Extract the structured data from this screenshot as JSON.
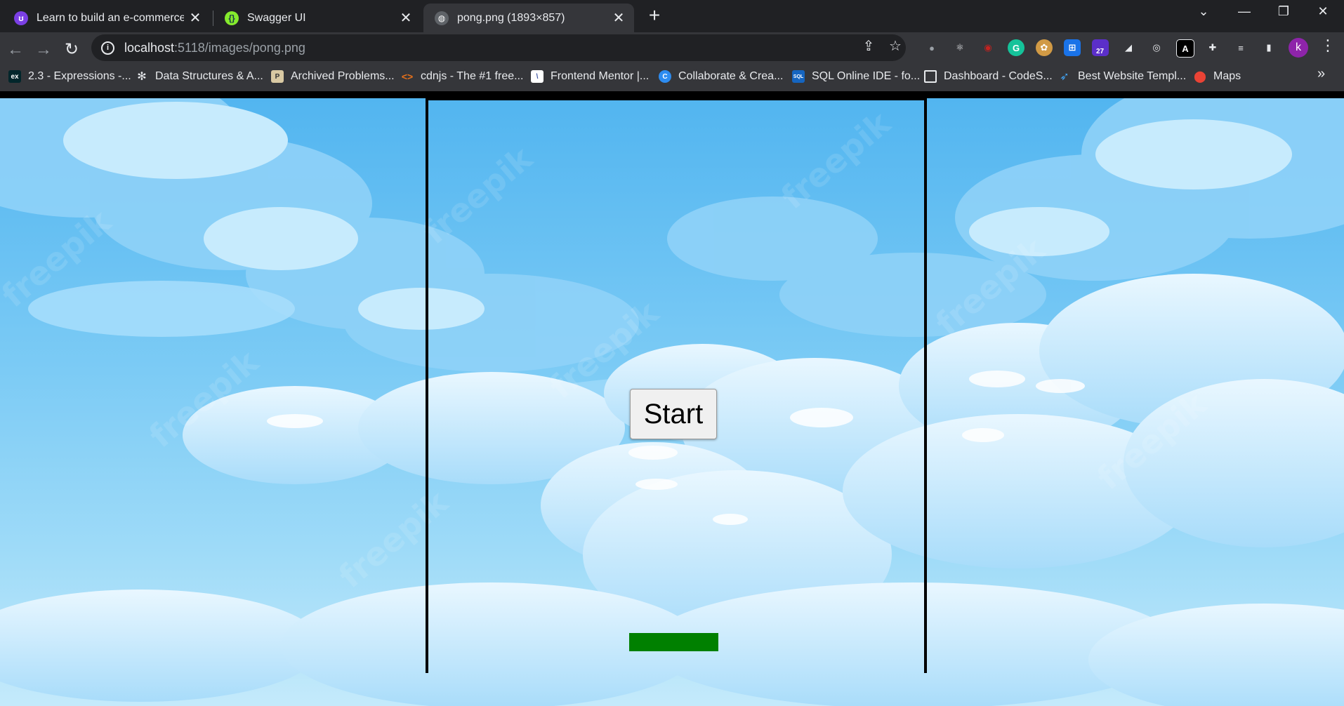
{
  "browser": {
    "tabs": [
      {
        "title": "Learn to build an e-commerce ap",
        "active": false,
        "favicon": "purple-shield-icon"
      },
      {
        "title": "Swagger UI",
        "active": false,
        "favicon": "swagger-icon"
      },
      {
        "title": "pong.png (1893×857)",
        "active": true,
        "favicon": "globe-icon"
      }
    ],
    "url_host": "localhost",
    "url_rest": ":5118/images/pong.png",
    "extension_badge": "27",
    "profile_initial": "k",
    "bookmarks": [
      {
        "label": "2.3 - Expressions -...",
        "icon": "edx-icon"
      },
      {
        "label": "Data Structures & A...",
        "icon": "gear-logo-icon"
      },
      {
        "label": "Archived Problems...",
        "icon": "pe-icon"
      },
      {
        "label": "cdnjs - The #1 free...",
        "icon": "code-brackets-icon"
      },
      {
        "label": "Frontend Mentor |...",
        "icon": "frontend-mentor-icon"
      },
      {
        "label": "Collaborate & Crea...",
        "icon": "canva-icon"
      },
      {
        "label": "SQL Online IDE - fo...",
        "icon": "sql-icon"
      },
      {
        "label": "Dashboard - CodeS...",
        "icon": "square-icon"
      },
      {
        "label": "Best Website Templ...",
        "icon": "bird-icon"
      },
      {
        "label": "Maps",
        "icon": "maps-pin-icon"
      }
    ]
  },
  "game": {
    "start_label": "Start",
    "paddle_color": "#008000",
    "watermark": "freepik"
  },
  "colors": {
    "tabstrip": "#202124",
    "toolbar": "#35363a",
    "sky": "#6cc4f2"
  }
}
